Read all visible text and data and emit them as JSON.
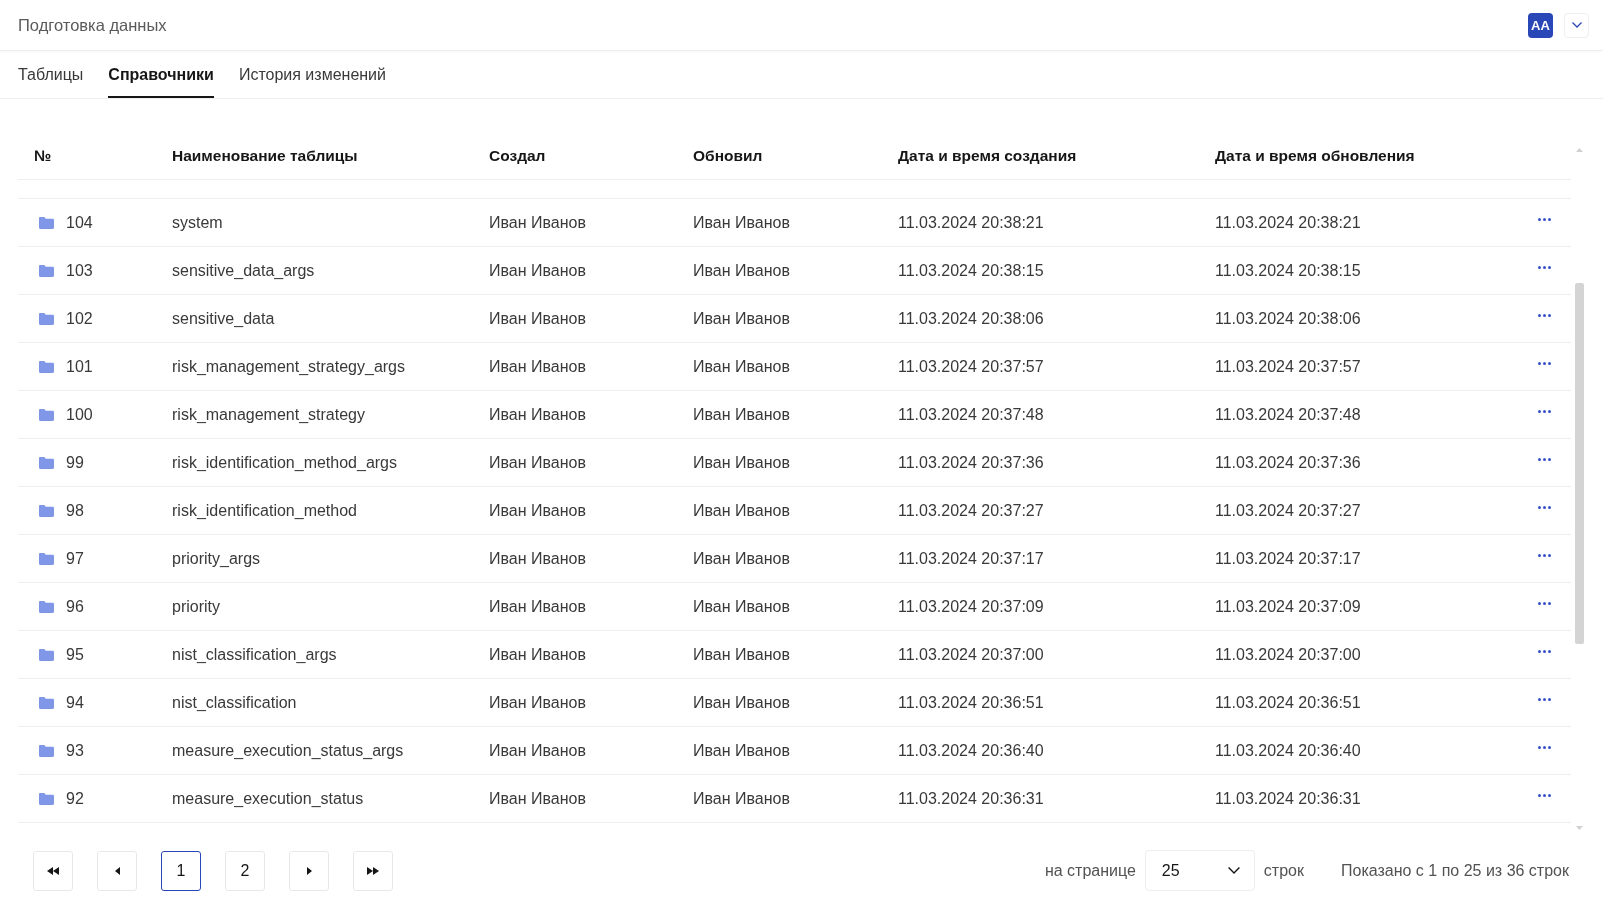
{
  "header": {
    "title": "Подготовка данных",
    "avatar": "AA"
  },
  "tabs": [
    {
      "label": "Таблицы",
      "selected": false
    },
    {
      "label": "Справочники",
      "selected": true
    },
    {
      "label": "История изменений",
      "selected": false
    }
  ],
  "table": {
    "columns": [
      "№",
      "Наименование таблицы",
      "Создал",
      "Обновил",
      "Дата и время создания",
      "Дата и время обновления"
    ],
    "rows": [
      {
        "number": "104",
        "name": "system",
        "created_by": "Иван Иванов",
        "updated_by": "Иван Иванов",
        "created_at": "11.03.2024 20:38:21",
        "updated_at": "11.03.2024 20:38:21"
      },
      {
        "number": "103",
        "name": "sensitive_data_args",
        "created_by": "Иван Иванов",
        "updated_by": "Иван Иванов",
        "created_at": "11.03.2024 20:38:15",
        "updated_at": "11.03.2024 20:38:15"
      },
      {
        "number": "102",
        "name": "sensitive_data",
        "created_by": "Иван Иванов",
        "updated_by": "Иван Иванов",
        "created_at": "11.03.2024 20:38:06",
        "updated_at": "11.03.2024 20:38:06"
      },
      {
        "number": "101",
        "name": "risk_management_strategy_args",
        "created_by": "Иван Иванов",
        "updated_by": "Иван Иванов",
        "created_at": "11.03.2024 20:37:57",
        "updated_at": "11.03.2024 20:37:57"
      },
      {
        "number": "100",
        "name": "risk_management_strategy",
        "created_by": "Иван Иванов",
        "updated_by": "Иван Иванов",
        "created_at": "11.03.2024 20:37:48",
        "updated_at": "11.03.2024 20:37:48"
      },
      {
        "number": "99",
        "name": "risk_identification_method_args",
        "created_by": "Иван Иванов",
        "updated_by": "Иван Иванов",
        "created_at": "11.03.2024 20:37:36",
        "updated_at": "11.03.2024 20:37:36"
      },
      {
        "number": "98",
        "name": "risk_identification_method",
        "created_by": "Иван Иванов",
        "updated_by": "Иван Иванов",
        "created_at": "11.03.2024 20:37:27",
        "updated_at": "11.03.2024 20:37:27"
      },
      {
        "number": "97",
        "name": "priority_args",
        "created_by": "Иван Иванов",
        "updated_by": "Иван Иванов",
        "created_at": "11.03.2024 20:37:17",
        "updated_at": "11.03.2024 20:37:17"
      },
      {
        "number": "96",
        "name": "priority",
        "created_by": "Иван Иванов",
        "updated_by": "Иван Иванов",
        "created_at": "11.03.2024 20:37:09",
        "updated_at": "11.03.2024 20:37:09"
      },
      {
        "number": "95",
        "name": "nist_classification_args",
        "created_by": "Иван Иванов",
        "updated_by": "Иван Иванов",
        "created_at": "11.03.2024 20:37:00",
        "updated_at": "11.03.2024 20:37:00"
      },
      {
        "number": "94",
        "name": "nist_classification",
        "created_by": "Иван Иванов",
        "updated_by": "Иван Иванов",
        "created_at": "11.03.2024 20:36:51",
        "updated_at": "11.03.2024 20:36:51"
      },
      {
        "number": "93",
        "name": "measure_execution_status_args",
        "created_by": "Иван Иванов",
        "updated_by": "Иван Иванов",
        "created_at": "11.03.2024 20:36:40",
        "updated_at": "11.03.2024 20:36:40"
      },
      {
        "number": "92",
        "name": "measure_execution_status",
        "created_by": "Иван Иванов",
        "updated_by": "Иван Иванов",
        "created_at": "11.03.2024 20:36:31",
        "updated_at": "11.03.2024 20:36:31"
      }
    ]
  },
  "pagination": {
    "pages": [
      {
        "label": "1",
        "selected": true
      },
      {
        "label": "2",
        "selected": false
      }
    ],
    "per_page_label": "на странице",
    "per_page_value": "25",
    "rows_label": "строк",
    "summary": "Показано с 1 по 25 из 36 строк"
  }
}
